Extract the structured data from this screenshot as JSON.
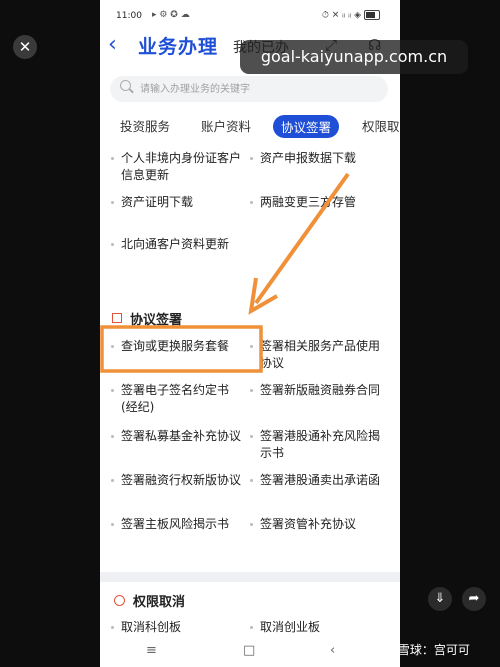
{
  "status": {
    "time": "11:00",
    "icons": "▸ ⚙ ✪ ☁",
    "right": "⏱ ✕ ᵢₗ ᵢₗ ◈"
  },
  "header": {
    "back_glyph": "‹",
    "title": "业务办理",
    "subtitle": "我的已办",
    "expand_glyph": "⤢",
    "headset_glyph": "☊"
  },
  "search": {
    "placeholder": "请输入办理业务的关键字"
  },
  "tabs": [
    {
      "label": "投资服务"
    },
    {
      "label": "账户资料"
    },
    {
      "label": "协议签署",
      "active": true
    },
    {
      "label": "权限取"
    }
  ],
  "account_items": [
    "个人非境内身份证客户信息更新",
    "资产申报数据下载",
    "资产证明下载",
    "两融变更三方存管",
    "北向通客户资料更新"
  ],
  "agreement_section": {
    "title": "协议签署"
  },
  "agreement_items": [
    "查询或更换服务套餐",
    "签署相关服务产品使用协议",
    "签署电子签名约定书(经纪)",
    "签署新版融资融券合同",
    "签署私募基金补充协议",
    "签署港股通补充风险揭示书",
    "签署融资行权新版协议",
    "签署港股通卖出承诺函",
    "签署主板风险揭示书",
    "签署资管补充协议"
  ],
  "cancel_section": {
    "title": "权限取消"
  },
  "cancel_items": [
    "取消科创板",
    "取消创业板"
  ],
  "nav": {
    "menu": "≡",
    "home": "□",
    "back": "‹"
  },
  "overlay": {
    "close_glyph": "✕",
    "watermark": "goal-kaiyunapp.com.cn",
    "download_glyph": "⇓",
    "share_glyph": "➦",
    "footer": "❄ 雪球：宫可可"
  },
  "colors": {
    "accent": "#1e4fd6",
    "highlight": "#f0913a",
    "section_icon": "#e0553b"
  }
}
